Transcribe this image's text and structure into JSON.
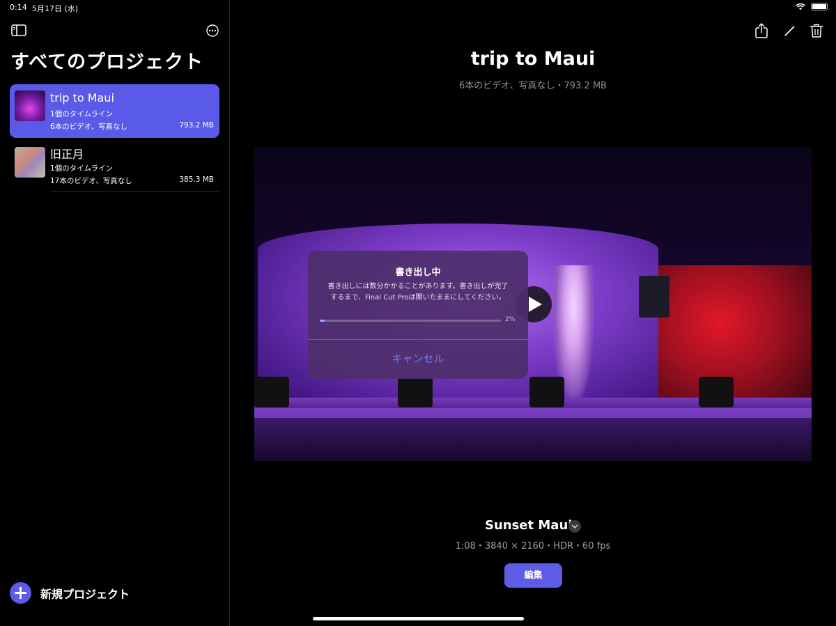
{
  "status": {
    "time": "0:14",
    "date": "5月17日 (水)"
  },
  "sidebar": {
    "title": "すべてのプロジェクト",
    "projects": [
      {
        "name": "trip to Maui",
        "timelines": "1個のタイムライン",
        "media": "6本のビデオ、写真なし",
        "size": "793.2 MB",
        "selected": true
      },
      {
        "name": "旧正月",
        "timelines": "1個のタイムライン",
        "media": "17本のビデオ、写真なし",
        "size": "385.3 MB",
        "selected": false
      }
    ],
    "new_project_label": "新規プロジェクト"
  },
  "main": {
    "title": "trip to Maui",
    "subtitle": "6本のビデオ、写真なし・793.2 MB",
    "timeline_name": "Sunset Maui",
    "timeline_meta": "1:08・3840 × 2160・HDR・60 fps",
    "edit_label": "編集"
  },
  "dialog": {
    "title": "書き出し中",
    "message_line1": "書き出しには数分かかることがあります。書き出しが完了",
    "message_line2": "するまで、Final Cut Proは開いたままにしてください。",
    "progress_label": "2%",
    "progress_value": 0.02,
    "cancel_label": "キャンセル"
  },
  "colors": {
    "accent": "#5e5ce6",
    "selected_row": "#5a5ae8",
    "dialog_bg": "#4e2e6c"
  },
  "icons": {
    "sidebar_toggle": "sidebar-icon",
    "more": "ellipsis-circle-icon",
    "share": "share-icon",
    "edit": "pencil-icon",
    "trash": "trash-icon",
    "play": "play-icon",
    "chevron": "chevron-down-icon",
    "add": "plus-circle-icon"
  }
}
